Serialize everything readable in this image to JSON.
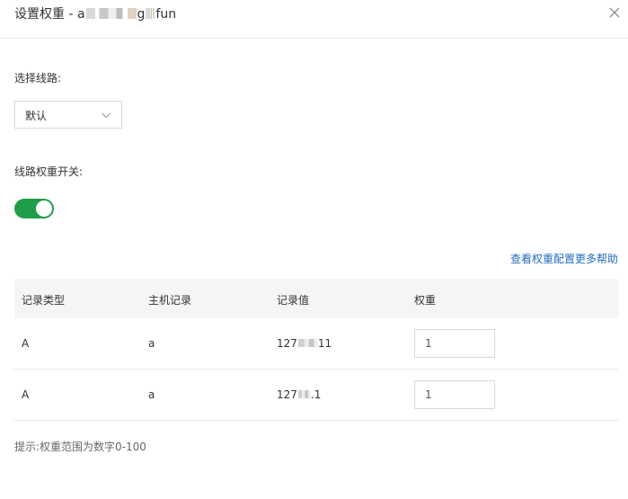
{
  "dialog": {
    "title_prefix": "设置权重 - a",
    "title_mid": "g",
    "title_suffix": "fun",
    "close_icon": "close-icon"
  },
  "route": {
    "label": "选择线路:",
    "selected": "默认"
  },
  "weight_switch": {
    "label": "线路权重开关:",
    "on": true,
    "color": "#1e9e47"
  },
  "help_link": "查看权重配置更多帮助",
  "table": {
    "headers": [
      "记录类型",
      "主机记录",
      "记录值",
      "权重"
    ],
    "rows": [
      {
        "type": "A",
        "host": "a",
        "value_prefix": "127",
        "value_suffix": "11",
        "weight": "1"
      },
      {
        "type": "A",
        "host": "a",
        "value_prefix": "127",
        "value_suffix": ".1",
        "weight": "1"
      }
    ]
  },
  "hint": "提示:权重范围为数字0-100",
  "colors": {
    "accent": "#1e9e47",
    "link": "#1f6cbf"
  }
}
